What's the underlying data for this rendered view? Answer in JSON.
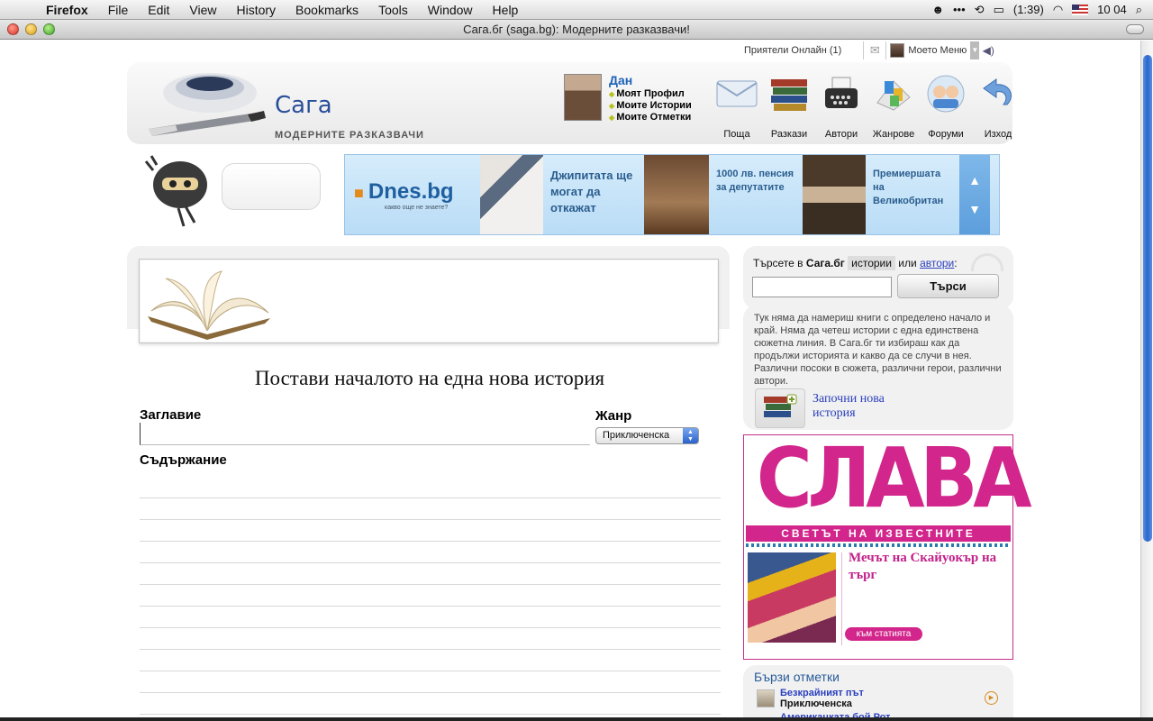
{
  "menubar": {
    "app": "Firefox",
    "items": [
      "File",
      "Edit",
      "View",
      "History",
      "Bookmarks",
      "Tools",
      "Window",
      "Help"
    ],
    "battery": "(1:39)",
    "clock": "10 04"
  },
  "window": {
    "title": "Сага.бг (saga.bg): Модерните разказвачи!"
  },
  "topstrip": {
    "friends": "Приятели Онлайн (1)",
    "my_menu": "Моето Меню"
  },
  "header": {
    "brand": "Сага",
    "tagline": "МОДЕРНИТЕ РАЗКАЗВАЧИ",
    "user": {
      "name": "Дан",
      "links": [
        "Моят Профил",
        "Моите Истории",
        "Моите Отметки"
      ]
    },
    "nav": [
      {
        "label": "Поща",
        "icon": "mail-icon"
      },
      {
        "label": "Разкази",
        "icon": "books-icon"
      },
      {
        "label": "Автори",
        "icon": "typewriter-icon"
      },
      {
        "label": "Жанрове",
        "icon": "genres-icon"
      },
      {
        "label": "Форуми",
        "icon": "forums-icon"
      },
      {
        "label": "Изход",
        "icon": "logout-icon"
      }
    ]
  },
  "banner": {
    "logo": "Dnes.bg",
    "logo_sub": "какво още не знаете?",
    "headlines": [
      "Джипитата ще могат да откажат",
      "1000 лв. пенсия за депутатите",
      "Премиершата на Великобритан"
    ]
  },
  "form": {
    "heading": "Постави началото на една нова история",
    "title_label": "Заглавие",
    "genre_label": "Жанр",
    "genre_value": "Приключенска",
    "content_label": "Съдържание"
  },
  "sidebar": {
    "search": {
      "prefix": "Търсете в",
      "site": "Сага.бг",
      "tab_stories": "истории",
      "or": "или",
      "tab_authors": "автори",
      "button": "Търси"
    },
    "about": "Тук няма да намериш книги с определено начало и край. Няма да четеш истории с една единствена сюжетна линия. В Сага.бг ти избираш как да продължи историята и какво да се случи в нея. Различни посоки в сюжета, различни герои, различни автори.",
    "new_story": "Започни нова история",
    "ad": {
      "masthead": "СЛАВА",
      "strap": "СВЕТЪТ НА ИЗВЕСТНИТЕ",
      "story": "Мечът на Скайуокър на търг",
      "more": "към статията"
    },
    "bookmarks": {
      "title": "Бързи отметки",
      "items": [
        {
          "name": "Безкрайният път",
          "genre": "Приключенска"
        },
        {
          "name": "Америкацката бой Рот",
          "genre": ""
        }
      ]
    }
  },
  "colors": {
    "brand_blue": "#2a4f9a",
    "link_blue": "#2a3fbf",
    "slava_pink": "#d2268c"
  }
}
